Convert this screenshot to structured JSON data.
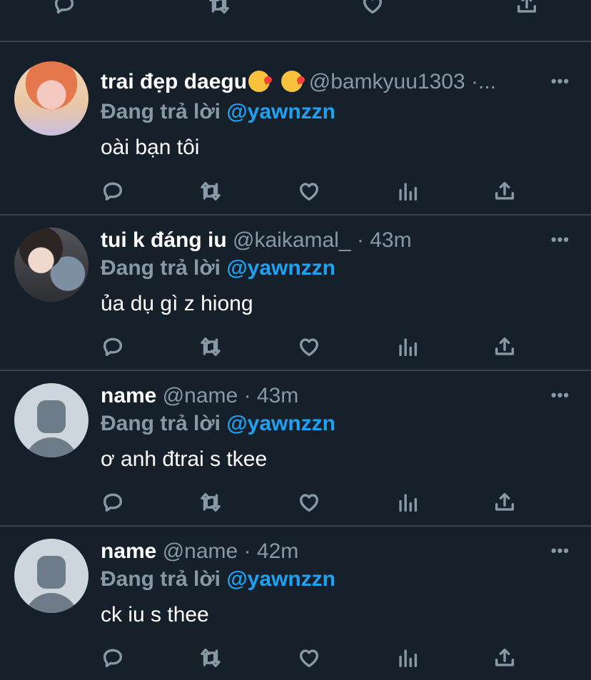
{
  "tweets": [
    {
      "display_name": "trai đẹp daegu",
      "handle": "@bamkyuu1303",
      "separator": "·",
      "time": "...",
      "more": "•••",
      "reply_prefix": "Đang trả lời",
      "reply_to": "@yawnzzn",
      "text": "oài bạn tôi",
      "avatar": "photo-avatar",
      "emojis": [
        "kissing-face-emoji",
        "kissing-face-emoji"
      ]
    },
    {
      "display_name": "tui k đáng iu",
      "handle": "@kaikamal_",
      "separator": "·",
      "time": "43m",
      "more": "•••",
      "reply_prefix": "Đang trả lời",
      "reply_to": "@yawnzzn",
      "text": "ủa dụ gì z hiong",
      "avatar": "photo-avatar"
    },
    {
      "display_name": "name",
      "handle": "@name",
      "separator": "·",
      "time": "43m",
      "more": "•••",
      "reply_prefix": "Đang trả lời",
      "reply_to": "@yawnzzn",
      "text": "ơ anh đtrai s tkee",
      "avatar": "default-avatar"
    },
    {
      "display_name": "name",
      "handle": "@name",
      "separator": "·",
      "time": "42m",
      "more": "•••",
      "reply_prefix": "Đang trả lời",
      "reply_to": "@yawnzzn",
      "text": "ck iu s thee",
      "avatar": "default-avatar"
    }
  ],
  "action_icons": [
    "reply-icon",
    "retweet-icon",
    "like-icon",
    "analytics-icon",
    "share-icon"
  ],
  "colors": {
    "background": "#15202b",
    "divider": "#38444d",
    "secondary_text": "#8899a6",
    "link": "#1da1f2",
    "primary_text": "#ffffff"
  }
}
